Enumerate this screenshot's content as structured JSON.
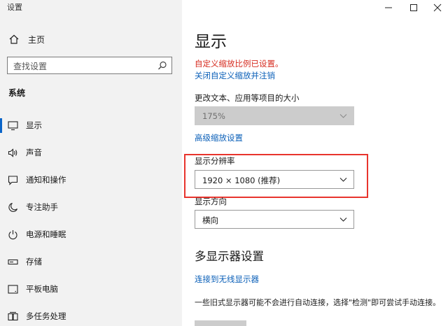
{
  "window": {
    "title": "设置"
  },
  "sidebar": {
    "home_label": "主页",
    "search_placeholder": "查找设置",
    "section_label": "系统",
    "items": [
      {
        "label": "显示",
        "icon": "display-icon",
        "active": true
      },
      {
        "label": "声音",
        "icon": "speaker-icon"
      },
      {
        "label": "通知和操作",
        "icon": "notification-icon"
      },
      {
        "label": "专注助手",
        "icon": "moon-icon"
      },
      {
        "label": "电源和睡眠",
        "icon": "power-icon"
      },
      {
        "label": "存储",
        "icon": "storage-icon"
      },
      {
        "label": "平板电脑",
        "icon": "tablet-icon"
      },
      {
        "label": "多任务处理",
        "icon": "multitask-icon"
      }
    ]
  },
  "main": {
    "title": "显示",
    "custom_scale_warning": "自定义缩放比例已设置。",
    "turn_off_custom_scale_link": "关闭自定义缩放并注销",
    "scale_label": "更改文本、应用等项目的大小",
    "scale_value": "175%",
    "advanced_scaling_link": "高级缩放设置",
    "resolution_label": "显示分辨率",
    "resolution_value": "1920 × 1080 (推荐)",
    "orientation_label": "显示方向",
    "orientation_value": "横向",
    "multi_display_heading": "多显示器设置",
    "wireless_link": "连接到无线显示器",
    "multi_display_desc": "一些旧式显示器可能不会进行自动连接，选择\"检测\"即可尝试手动连接。"
  },
  "colors": {
    "accent": "#0a64c8",
    "warning": "#d62b1f",
    "link": "#0a5fb8",
    "highlight_box": "#e8342d"
  }
}
